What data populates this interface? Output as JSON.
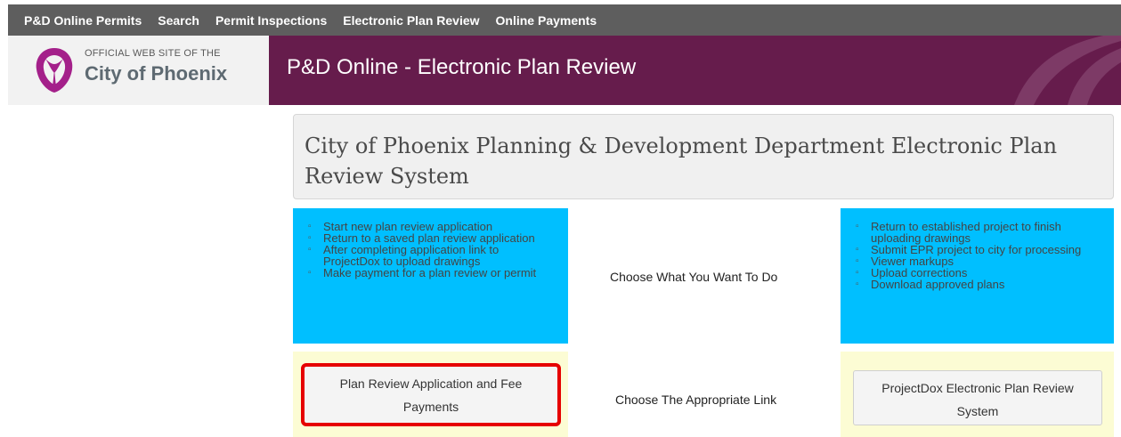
{
  "topnav": {
    "items": [
      "P&D Online Permits",
      "Search",
      "Permit Inspections",
      "Electronic Plan Review",
      "Online Payments"
    ]
  },
  "header": {
    "logo_small": "OFFICIAL WEB SITE OF THE",
    "logo_big": "City of Phoenix",
    "banner_title": "P&D Online - Electronic Plan Review",
    "colors": {
      "banner": "#661c4c",
      "logo": "#a4208a"
    }
  },
  "main": {
    "title": "City of Phoenix Planning & Development Department Electronic Plan Review System",
    "left_list": [
      "Start new plan review application",
      "Return to a saved plan review application",
      "After completing application link to ProjectDox to upload drawings",
      "Make payment for a plan review or permit"
    ],
    "right_list": [
      "Return to established project to finish uploading drawings",
      "Submit EPR project to city for processing",
      "Viewer markups",
      "Upload corrections",
      "Download approved plans"
    ],
    "choose_text": "Choose What You Want To Do",
    "link_text": "Choose The Appropriate Link",
    "left_button": "Plan Review Application and Fee Payments",
    "right_button": "ProjectDox Electronic Plan Review System",
    "colors": {
      "info_box": "#00bfff",
      "link_box": "#fcfcd4",
      "highlight": "#e60000"
    }
  }
}
